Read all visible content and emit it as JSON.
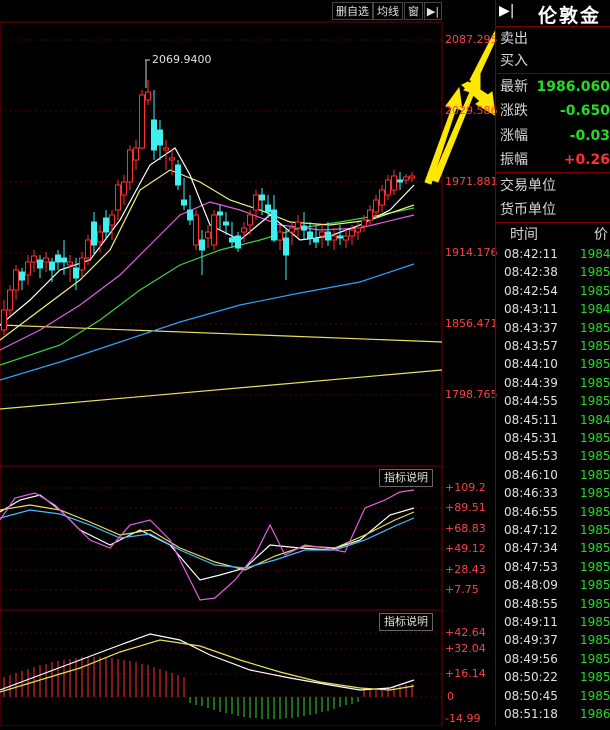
{
  "toolbar": {
    "delete_watch_label": "删自选",
    "ma_label": "均线",
    "window_label": "窗",
    "play_icon": "play-icon"
  },
  "price_axis": {
    "labels": [
      "2087.295",
      "2029.586",
      "1971.881",
      "1914.176",
      "1856.471",
      "1798.765"
    ]
  },
  "peak_annotation": "2069.9400",
  "indicator1": {
    "button_label": "指标说明",
    "axis_labels": [
      "+109.2",
      "+89.51",
      "+68.83",
      "+49.12",
      "+28.43",
      "+7.75"
    ]
  },
  "indicator2": {
    "button_label": "指标说明",
    "axis_labels": [
      "+42.64",
      "+32.04",
      "+16.14",
      "0",
      "-14.99"
    ]
  },
  "quote_panel": {
    "title": "伦敦金",
    "sell_label": "卖出",
    "buy_label": "买入",
    "latest_label": "最新",
    "latest_value": "1986.060",
    "change_label": "涨跌",
    "change_value": "-0.650",
    "change_pct_label": "涨幅",
    "change_pct_value": "-0.03",
    "amplitude_label": "振幅",
    "amplitude_value": "+0.26",
    "trade_unit_label": "交易单位",
    "currency_unit_label": "货币单位",
    "col_time": "时间",
    "col_price": "价",
    "colors": {
      "up": "#ff3030",
      "down": "#22dd22",
      "text": "#d8d8d8"
    }
  },
  "ticks": [
    {
      "time": "08:42:11",
      "price": "1984"
    },
    {
      "time": "08:42:38",
      "price": "1985"
    },
    {
      "time": "08:42:54",
      "price": "1985"
    },
    {
      "time": "08:43:11",
      "price": "1984"
    },
    {
      "time": "08:43:37",
      "price": "1985"
    },
    {
      "time": "08:43:57",
      "price": "1985"
    },
    {
      "time": "08:44:10",
      "price": "1985"
    },
    {
      "time": "08:44:39",
      "price": "1985"
    },
    {
      "time": "08:44:55",
      "price": "1985"
    },
    {
      "time": "08:45:11",
      "price": "1984"
    },
    {
      "time": "08:45:31",
      "price": "1985"
    },
    {
      "time": "08:45:53",
      "price": "1985"
    },
    {
      "time": "08:46:10",
      "price": "1985"
    },
    {
      "time": "08:46:33",
      "price": "1985"
    },
    {
      "time": "08:46:55",
      "price": "1985"
    },
    {
      "time": "08:47:12",
      "price": "1985"
    },
    {
      "time": "08:47:34",
      "price": "1985"
    },
    {
      "time": "08:47:53",
      "price": "1985"
    },
    {
      "time": "08:48:09",
      "price": "1985"
    },
    {
      "time": "08:48:55",
      "price": "1985"
    },
    {
      "time": "08:49:11",
      "price": "1985"
    },
    {
      "time": "08:49:37",
      "price": "1985"
    },
    {
      "time": "08:49:56",
      "price": "1985"
    },
    {
      "time": "08:50:22",
      "price": "1985"
    },
    {
      "time": "08:50:45",
      "price": "1985"
    },
    {
      "time": "08:51:18",
      "price": "1986"
    }
  ]
}
